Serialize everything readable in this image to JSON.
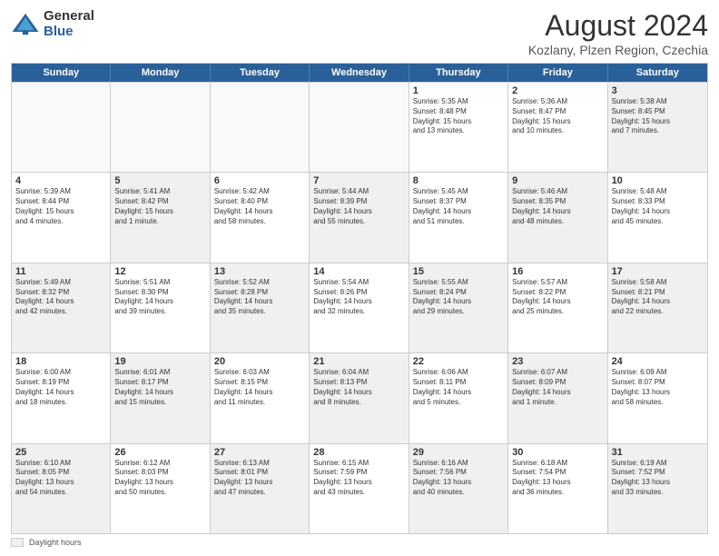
{
  "logo": {
    "general": "General",
    "blue": "Blue"
  },
  "title": "August 2024",
  "subtitle": "Kozlany, Plzen Region, Czechia",
  "header_days": [
    "Sunday",
    "Monday",
    "Tuesday",
    "Wednesday",
    "Thursday",
    "Friday",
    "Saturday"
  ],
  "footer_label": "Daylight hours",
  "rows": [
    [
      {
        "day": "",
        "text": "",
        "empty": true
      },
      {
        "day": "",
        "text": "",
        "empty": true
      },
      {
        "day": "",
        "text": "",
        "empty": true
      },
      {
        "day": "",
        "text": "",
        "empty": true
      },
      {
        "day": "1",
        "text": "Sunrise: 5:35 AM\nSunset: 8:48 PM\nDaylight: 15 hours\nand 13 minutes."
      },
      {
        "day": "2",
        "text": "Sunrise: 5:36 AM\nSunset: 8:47 PM\nDaylight: 15 hours\nand 10 minutes."
      },
      {
        "day": "3",
        "text": "Sunrise: 5:38 AM\nSunset: 8:45 PM\nDaylight: 15 hours\nand 7 minutes.",
        "shaded": true
      }
    ],
    [
      {
        "day": "4",
        "text": "Sunrise: 5:39 AM\nSunset: 8:44 PM\nDaylight: 15 hours\nand 4 minutes."
      },
      {
        "day": "5",
        "text": "Sunrise: 5:41 AM\nSunset: 8:42 PM\nDaylight: 15 hours\nand 1 minute.",
        "shaded": true
      },
      {
        "day": "6",
        "text": "Sunrise: 5:42 AM\nSunset: 8:40 PM\nDaylight: 14 hours\nand 58 minutes."
      },
      {
        "day": "7",
        "text": "Sunrise: 5:44 AM\nSunset: 8:39 PM\nDaylight: 14 hours\nand 55 minutes.",
        "shaded": true
      },
      {
        "day": "8",
        "text": "Sunrise: 5:45 AM\nSunset: 8:37 PM\nDaylight: 14 hours\nand 51 minutes."
      },
      {
        "day": "9",
        "text": "Sunrise: 5:46 AM\nSunset: 8:35 PM\nDaylight: 14 hours\nand 48 minutes.",
        "shaded": true
      },
      {
        "day": "10",
        "text": "Sunrise: 5:48 AM\nSunset: 8:33 PM\nDaylight: 14 hours\nand 45 minutes."
      }
    ],
    [
      {
        "day": "11",
        "text": "Sunrise: 5:49 AM\nSunset: 8:32 PM\nDaylight: 14 hours\nand 42 minutes.",
        "shaded": true
      },
      {
        "day": "12",
        "text": "Sunrise: 5:51 AM\nSunset: 8:30 PM\nDaylight: 14 hours\nand 39 minutes."
      },
      {
        "day": "13",
        "text": "Sunrise: 5:52 AM\nSunset: 8:28 PM\nDaylight: 14 hours\nand 35 minutes.",
        "shaded": true
      },
      {
        "day": "14",
        "text": "Sunrise: 5:54 AM\nSunset: 8:26 PM\nDaylight: 14 hours\nand 32 minutes."
      },
      {
        "day": "15",
        "text": "Sunrise: 5:55 AM\nSunset: 8:24 PM\nDaylight: 14 hours\nand 29 minutes.",
        "shaded": true
      },
      {
        "day": "16",
        "text": "Sunrise: 5:57 AM\nSunset: 8:22 PM\nDaylight: 14 hours\nand 25 minutes."
      },
      {
        "day": "17",
        "text": "Sunrise: 5:58 AM\nSunset: 8:21 PM\nDaylight: 14 hours\nand 22 minutes.",
        "shaded": true
      }
    ],
    [
      {
        "day": "18",
        "text": "Sunrise: 6:00 AM\nSunset: 8:19 PM\nDaylight: 14 hours\nand 18 minutes."
      },
      {
        "day": "19",
        "text": "Sunrise: 6:01 AM\nSunset: 8:17 PM\nDaylight: 14 hours\nand 15 minutes.",
        "shaded": true
      },
      {
        "day": "20",
        "text": "Sunrise: 6:03 AM\nSunset: 8:15 PM\nDaylight: 14 hours\nand 11 minutes."
      },
      {
        "day": "21",
        "text": "Sunrise: 6:04 AM\nSunset: 8:13 PM\nDaylight: 14 hours\nand 8 minutes.",
        "shaded": true
      },
      {
        "day": "22",
        "text": "Sunrise: 6:06 AM\nSunset: 8:11 PM\nDaylight: 14 hours\nand 5 minutes."
      },
      {
        "day": "23",
        "text": "Sunrise: 6:07 AM\nSunset: 8:09 PM\nDaylight: 14 hours\nand 1 minute.",
        "shaded": true
      },
      {
        "day": "24",
        "text": "Sunrise: 6:09 AM\nSunset: 8:07 PM\nDaylight: 13 hours\nand 58 minutes."
      }
    ],
    [
      {
        "day": "25",
        "text": "Sunrise: 6:10 AM\nSunset: 8:05 PM\nDaylight: 13 hours\nand 54 minutes.",
        "shaded": true
      },
      {
        "day": "26",
        "text": "Sunrise: 6:12 AM\nSunset: 8:03 PM\nDaylight: 13 hours\nand 50 minutes."
      },
      {
        "day": "27",
        "text": "Sunrise: 6:13 AM\nSunset: 8:01 PM\nDaylight: 13 hours\nand 47 minutes.",
        "shaded": true
      },
      {
        "day": "28",
        "text": "Sunrise: 6:15 AM\nSunset: 7:59 PM\nDaylight: 13 hours\nand 43 minutes."
      },
      {
        "day": "29",
        "text": "Sunrise: 6:16 AM\nSunset: 7:56 PM\nDaylight: 13 hours\nand 40 minutes.",
        "shaded": true
      },
      {
        "day": "30",
        "text": "Sunrise: 6:18 AM\nSunset: 7:54 PM\nDaylight: 13 hours\nand 36 minutes."
      },
      {
        "day": "31",
        "text": "Sunrise: 6:19 AM\nSunset: 7:52 PM\nDaylight: 13 hours\nand 33 minutes.",
        "shaded": true
      }
    ]
  ]
}
